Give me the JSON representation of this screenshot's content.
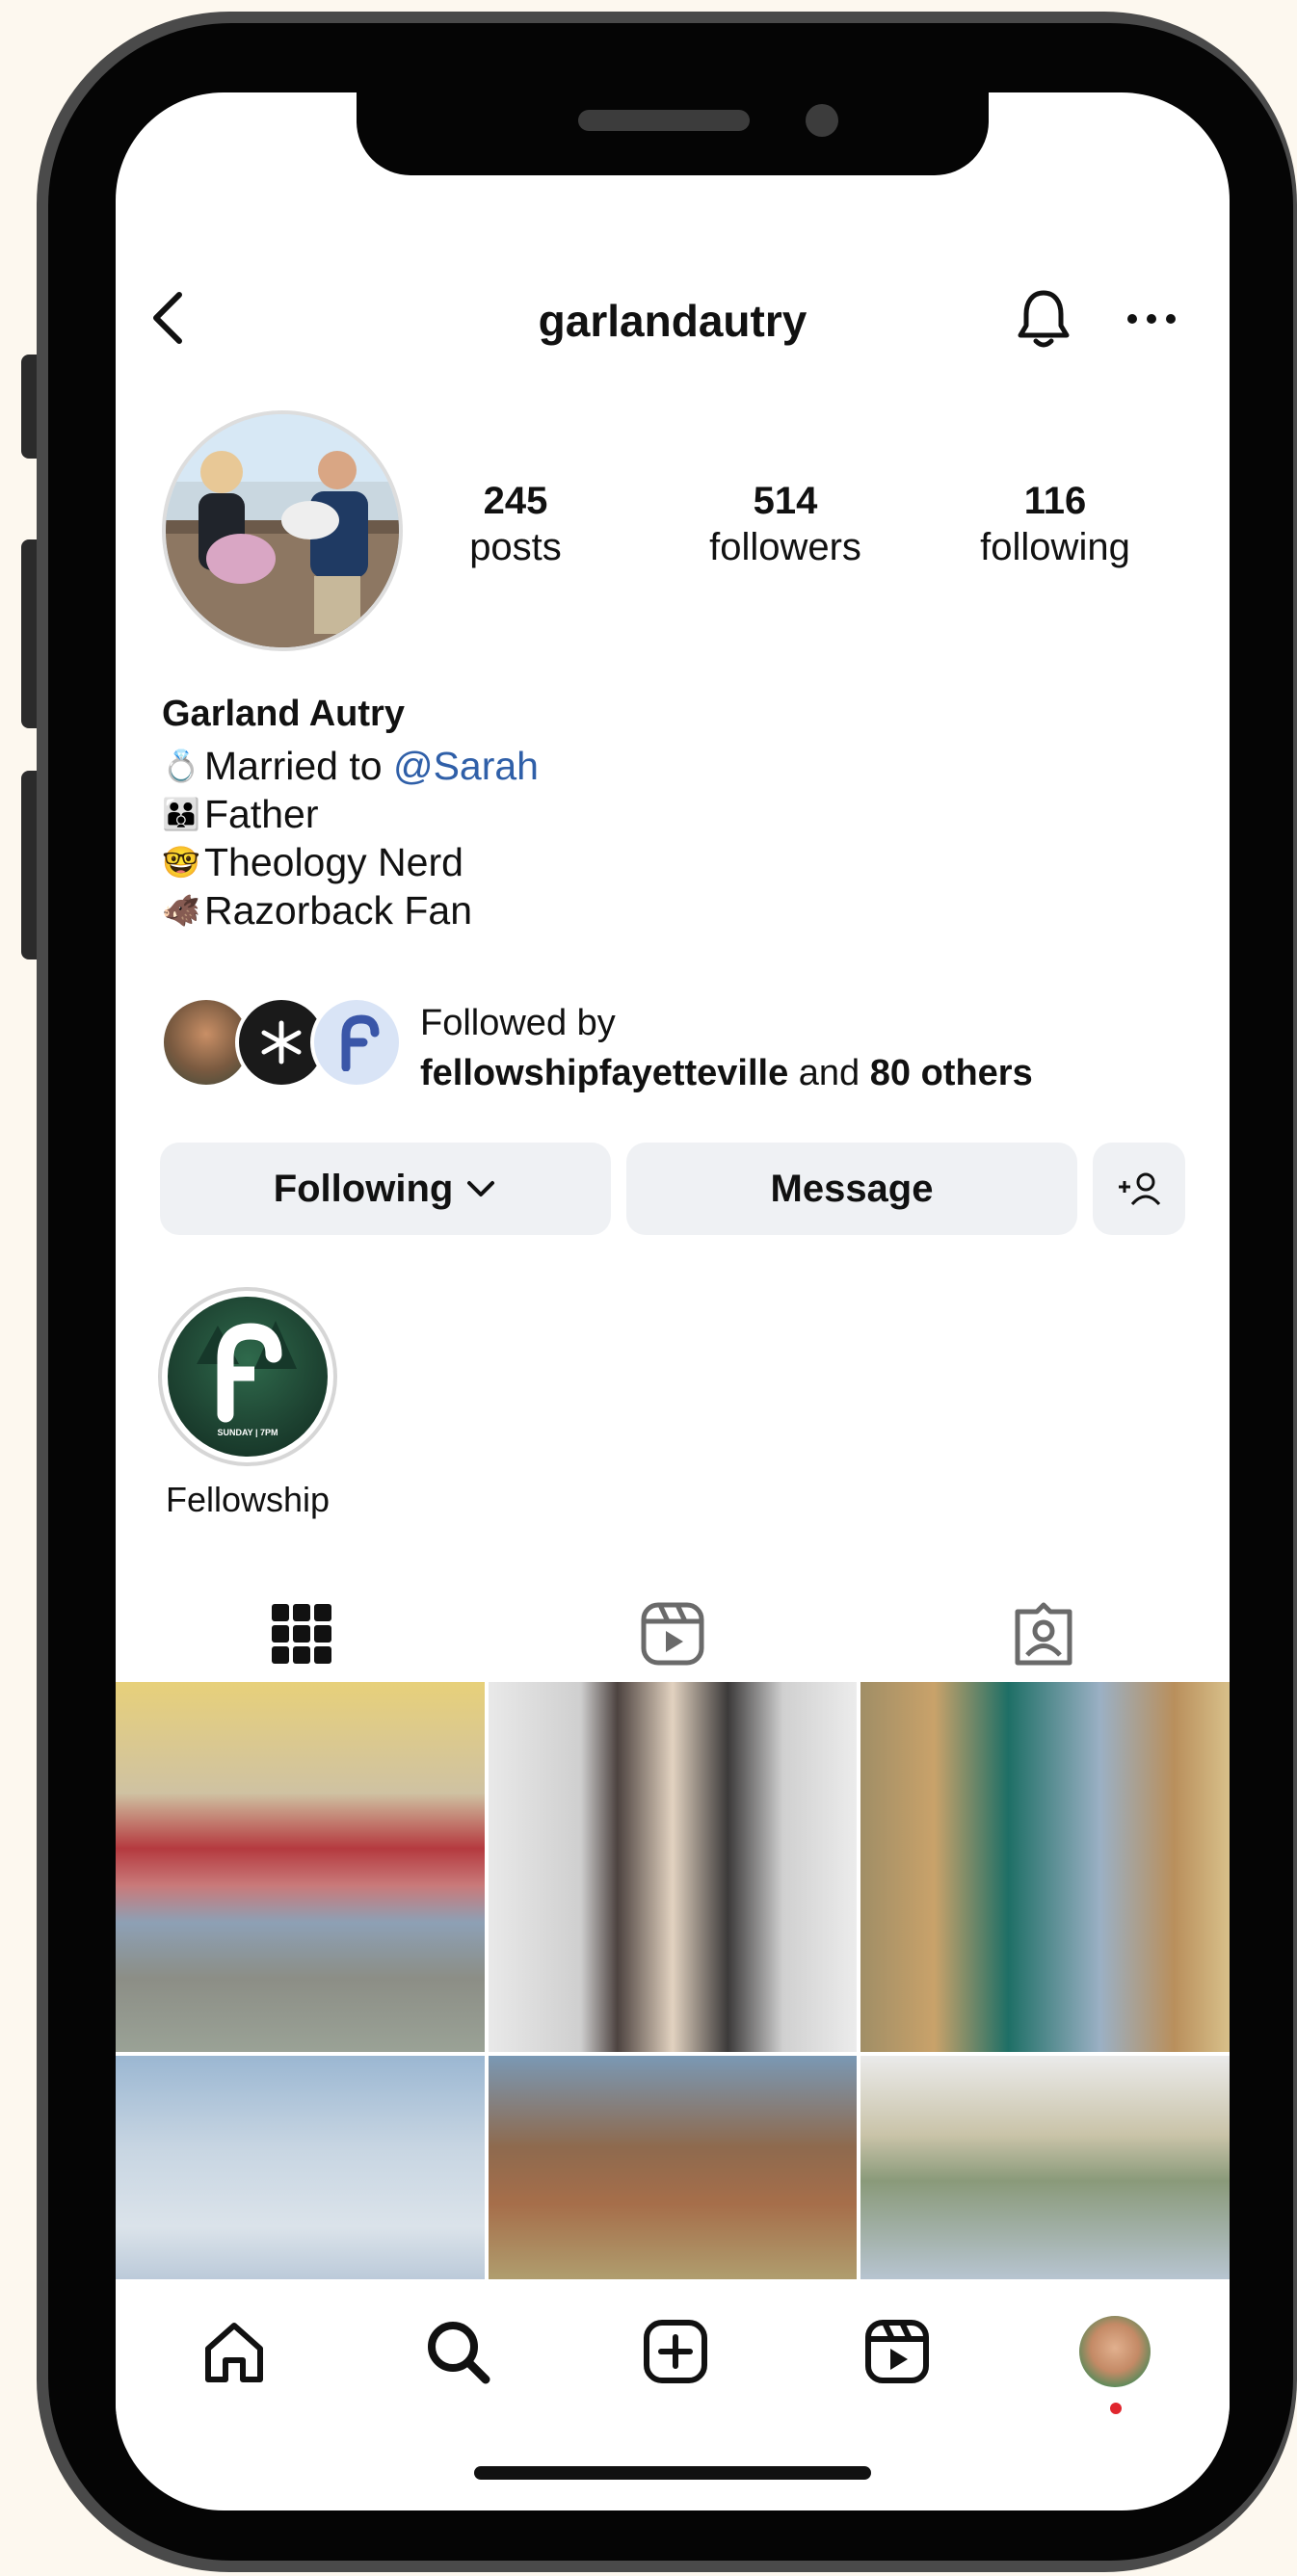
{
  "header": {
    "username": "garlandautry"
  },
  "stats": [
    {
      "value": "245",
      "label": "posts"
    },
    {
      "value": "514",
      "label": "followers"
    },
    {
      "value": "116",
      "label": "following"
    }
  ],
  "bio": {
    "name": "Garland Autry",
    "lines": [
      {
        "emoji": "💍",
        "text": "Married to ",
        "mention": "@Sarah"
      },
      {
        "emoji": "👪",
        "text": "Father"
      },
      {
        "emoji": "🤓",
        "text": "Theology Nerd"
      },
      {
        "emoji": "🐗",
        "text": "Razorback Fan"
      }
    ]
  },
  "followed_by": {
    "prefix": "Followed by",
    "account": "fellowshipfayetteville",
    "joiner": " and ",
    "others": "80 others"
  },
  "actions": {
    "following_label": "Following",
    "message_label": "Message"
  },
  "highlights": [
    {
      "label": "Fellowship",
      "cover_text": "SUNDAY | 7PM"
    }
  ],
  "tabs": [
    {
      "icon": "grid-icon"
    },
    {
      "icon": "reels-icon"
    },
    {
      "icon": "tagged-icon"
    }
  ],
  "bottom_nav": [
    "home-icon",
    "search-icon",
    "create-icon",
    "reels-icon",
    "profile-avatar"
  ],
  "colors": {
    "accent": "#2f5fa8",
    "button_bg": "#eff1f4",
    "notification_dot": "#e0262e"
  }
}
